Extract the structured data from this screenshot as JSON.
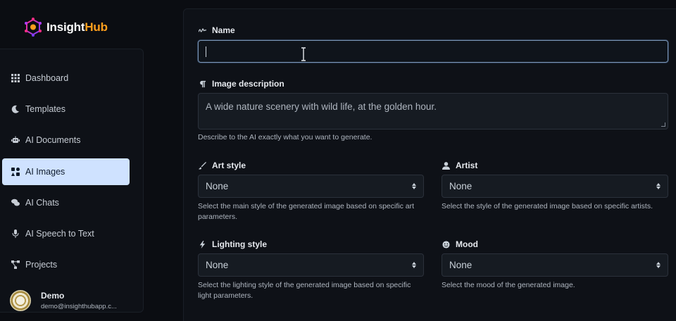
{
  "brand": {
    "name_part1": "Insight",
    "name_part2": "Hub",
    "accent": "#ff9f1c"
  },
  "sidebar": {
    "items": [
      {
        "label": "Dashboard",
        "icon": "grid-icon"
      },
      {
        "label": "Templates",
        "icon": "moon-icon"
      },
      {
        "label": "AI Documents",
        "icon": "robot-icon"
      },
      {
        "label": "AI Images",
        "icon": "image-icon",
        "active": true
      },
      {
        "label": "AI Chats",
        "icon": "chat-icon"
      },
      {
        "label": "AI Speech to Text",
        "icon": "microphone-icon"
      },
      {
        "label": "Projects",
        "icon": "project-diagram-icon"
      }
    ],
    "user": {
      "name": "Demo",
      "email": "demo@insighthubapp.c..."
    }
  },
  "form": {
    "name": {
      "label": "Name",
      "value": "",
      "icon": "signature-icon"
    },
    "description": {
      "label": "Image description",
      "placeholder": "A wide nature scenery with wild life, at the golden hour.",
      "help": "Describe to the AI exactly what you want to generate.",
      "icon": "paragraph-icon"
    },
    "art_style": {
      "label": "Art style",
      "value": "None",
      "icon": "brush-icon",
      "help_line1": "Select the main style of the generated image based on specific art",
      "help_line2": "parameters."
    },
    "artist": {
      "label": "Artist",
      "value": "None",
      "icon": "user-icon",
      "help_line1": "Select the style of the generated image based on specific artists."
    },
    "lighting": {
      "label": "Lighting style",
      "value": "None",
      "icon": "bolt-icon",
      "help_line1": "Select the lighting style of the generated image based on specific",
      "help_line2": "light parameters."
    },
    "mood": {
      "label": "Mood",
      "value": "None",
      "icon": "smile-icon",
      "help_line1": "Select the mood of the generated image."
    }
  }
}
